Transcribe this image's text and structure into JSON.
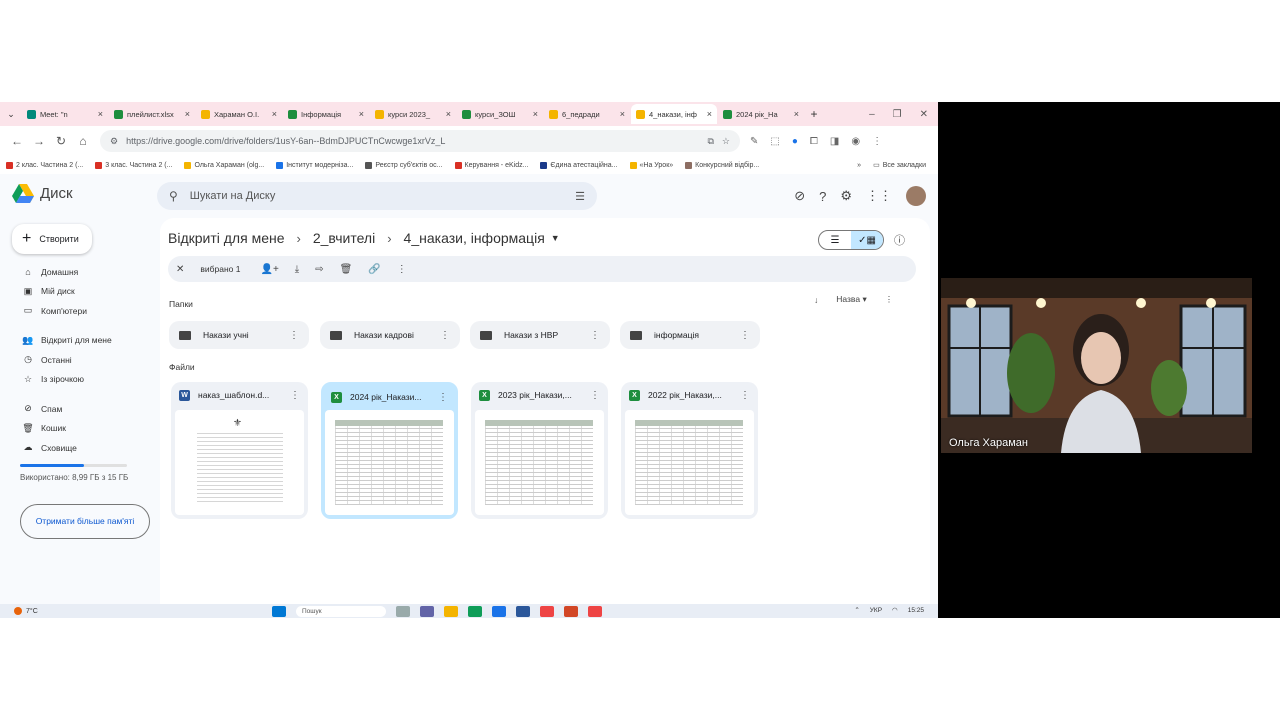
{
  "browser": {
    "tabs": [
      {
        "label": "Meet: \"n",
        "favicon_color": "#00897b",
        "active": false
      },
      {
        "label": "плейлист.xlsx",
        "favicon_color": "#1e8e3e",
        "active": false
      },
      {
        "label": "Хараман О.І.",
        "favicon_color": "#f4b400",
        "active": false
      },
      {
        "label": "Інформація",
        "favicon_color": "#1e8e3e",
        "active": false
      },
      {
        "label": "курси 2023_",
        "favicon_color": "#f4b400",
        "active": false
      },
      {
        "label": "курси_ЗОШ",
        "favicon_color": "#1e8e3e",
        "active": false
      },
      {
        "label": "6_педради",
        "favicon_color": "#f4b400",
        "active": false
      },
      {
        "label": "4_накази, інф",
        "favicon_color": "#f4b400",
        "active": true
      },
      {
        "label": "2024 рік_На",
        "favicon_color": "#1e8e3e",
        "active": false
      }
    ],
    "url": "https://drive.google.com/drive/folders/1usY-6an--BdmDJPUCTnCwcwge1xrVz_L",
    "bookmarks": [
      {
        "label": "2 клас. Частина 2 (...",
        "color": "#d93025"
      },
      {
        "label": "3 клас. Частина 2 (...",
        "color": "#d93025"
      },
      {
        "label": "Ольга Хараман (olg...",
        "color": "#f4b400"
      },
      {
        "label": "Інститут модерніза...",
        "color": "#1a73e8"
      },
      {
        "label": "Реєстр суб'єктів ос...",
        "color": "#555555"
      },
      {
        "label": "Керування - eKidz...",
        "color": "#d93025"
      },
      {
        "label": "Єдина атестаційна...",
        "color": "#1a3a8a"
      },
      {
        "label": "«На Урок»",
        "color": "#f4b400"
      },
      {
        "label": "Конкурсний відбір...",
        "color": "#8d6e63"
      }
    ],
    "bookmarks_more": "»",
    "all_bookmarks": "Все закладки"
  },
  "drive": {
    "app_name": "Диск",
    "search_placeholder": "Шукати на Диску",
    "create_label": "Створити",
    "sidebar": [
      {
        "label": "Домашня",
        "icon": "⌂"
      },
      {
        "label": "Мій диск",
        "icon": "▣"
      },
      {
        "label": "Комп'ютери",
        "icon": "▭"
      },
      {
        "label": "Відкриті для мене",
        "icon": "👥"
      },
      {
        "label": "Останні",
        "icon": "◷"
      },
      {
        "label": "Із зірочкою",
        "icon": "☆"
      },
      {
        "label": "Спам",
        "icon": "⊘"
      },
      {
        "label": "Кошик",
        "icon": "🗑"
      },
      {
        "label": "Сховище",
        "icon": "☁"
      }
    ],
    "storage_used_fraction": 0.6,
    "storage_text": "Використано: 8,99 ГБ з 15 ГБ",
    "more_storage_label": "Отримати більше пам'яті",
    "breadcrumb": [
      "Відкриті для мене",
      "2_вчителі",
      "4_накази, інформація"
    ],
    "selection_text": "вибрано 1",
    "folders_label": "Папки",
    "sort_label": "Назва",
    "folders": [
      "Накази учні",
      "Накази кадрові",
      "Накази з НВР",
      "інформація"
    ],
    "files_label": "Файли",
    "files": [
      {
        "name": "наказ_шаблон.d...",
        "type": "W",
        "type_color": "#2b579a",
        "thumb": "doc",
        "selected": false
      },
      {
        "name": "2024 рік_Накази...",
        "type": "X",
        "type_color": "#1e8e3e",
        "thumb": "sheet",
        "selected": true
      },
      {
        "name": "2023 рік_Накази,...",
        "type": "X",
        "type_color": "#1e8e3e",
        "thumb": "sheet",
        "selected": false
      },
      {
        "name": "2022 рік_Накази,...",
        "type": "X",
        "type_color": "#1e8e3e",
        "thumb": "sheet",
        "selected": false
      }
    ]
  },
  "taskbar": {
    "weather": "7°C",
    "search": "Пошук",
    "lang": "УКР",
    "time": "15:25"
  },
  "video": {
    "participant_name": "Ольга Хараман"
  }
}
